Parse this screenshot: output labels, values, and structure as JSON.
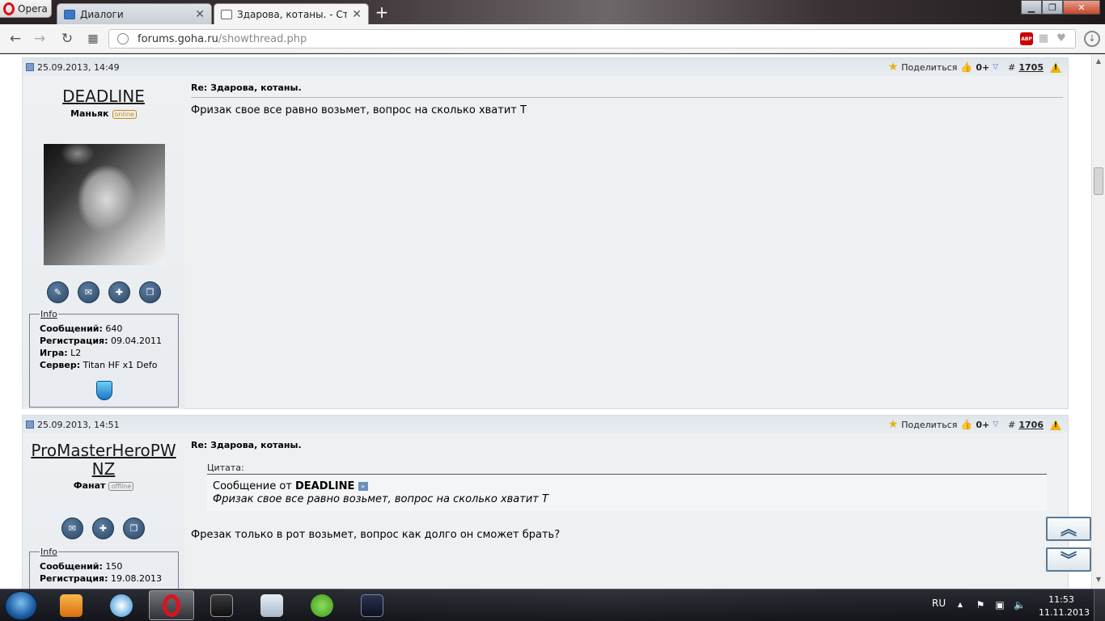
{
  "browser": {
    "menu_label": "Opera",
    "tabs": [
      {
        "label": "Диалоги",
        "active": false
      },
      {
        "label": "Здарова, котаны. - Стран",
        "active": true
      }
    ],
    "url_host": "forums.goha.ru",
    "url_path": "/showthread.php"
  },
  "posts": [
    {
      "date": "25.09.2013, 14:49",
      "share_label": "Поделиться",
      "rep": "0+",
      "number": "1705",
      "author": "DEADLINE",
      "user_title": "Маньяк",
      "status": "online",
      "info_label": "Info",
      "stats": [
        {
          "label": "Сообщений:",
          "value": "640"
        },
        {
          "label": "Регистрация:",
          "value": "09.04.2011"
        },
        {
          "label": "Игра:",
          "value": "L2"
        },
        {
          "label": "Сервер:",
          "value": "Titan HF x1 Defo"
        }
      ],
      "title": "Re: Здарова, котаны.",
      "text": "Фризак свое все равно возьмет, вопрос на сколько хватит Т"
    },
    {
      "date": "25.09.2013, 14:51",
      "share_label": "Поделиться",
      "rep": "0+",
      "number": "1706",
      "author_line1": "ProMasterHeroPW",
      "author_line2": "NZ",
      "user_title": "Фанат",
      "status": "offline",
      "info_label": "Info",
      "stats": [
        {
          "label": "Сообщений:",
          "value": "150"
        },
        {
          "label": "Регистрация:",
          "value": "19.08.2013"
        }
      ],
      "title": "Re: Здарова, котаны.",
      "quote": {
        "label": "Цитата:",
        "from_prefix": "Сообщение от",
        "from_user": "DEADLINE",
        "text": "Фризак свое все равно возьмет, вопрос на сколько хватит Т"
      },
      "text": "Фрезак только в рот возьмет, вопрос как долго он сможет брать?"
    }
  ],
  "taskbar": {
    "language": "RU",
    "time": "11:53",
    "date": "11.11.2013"
  }
}
